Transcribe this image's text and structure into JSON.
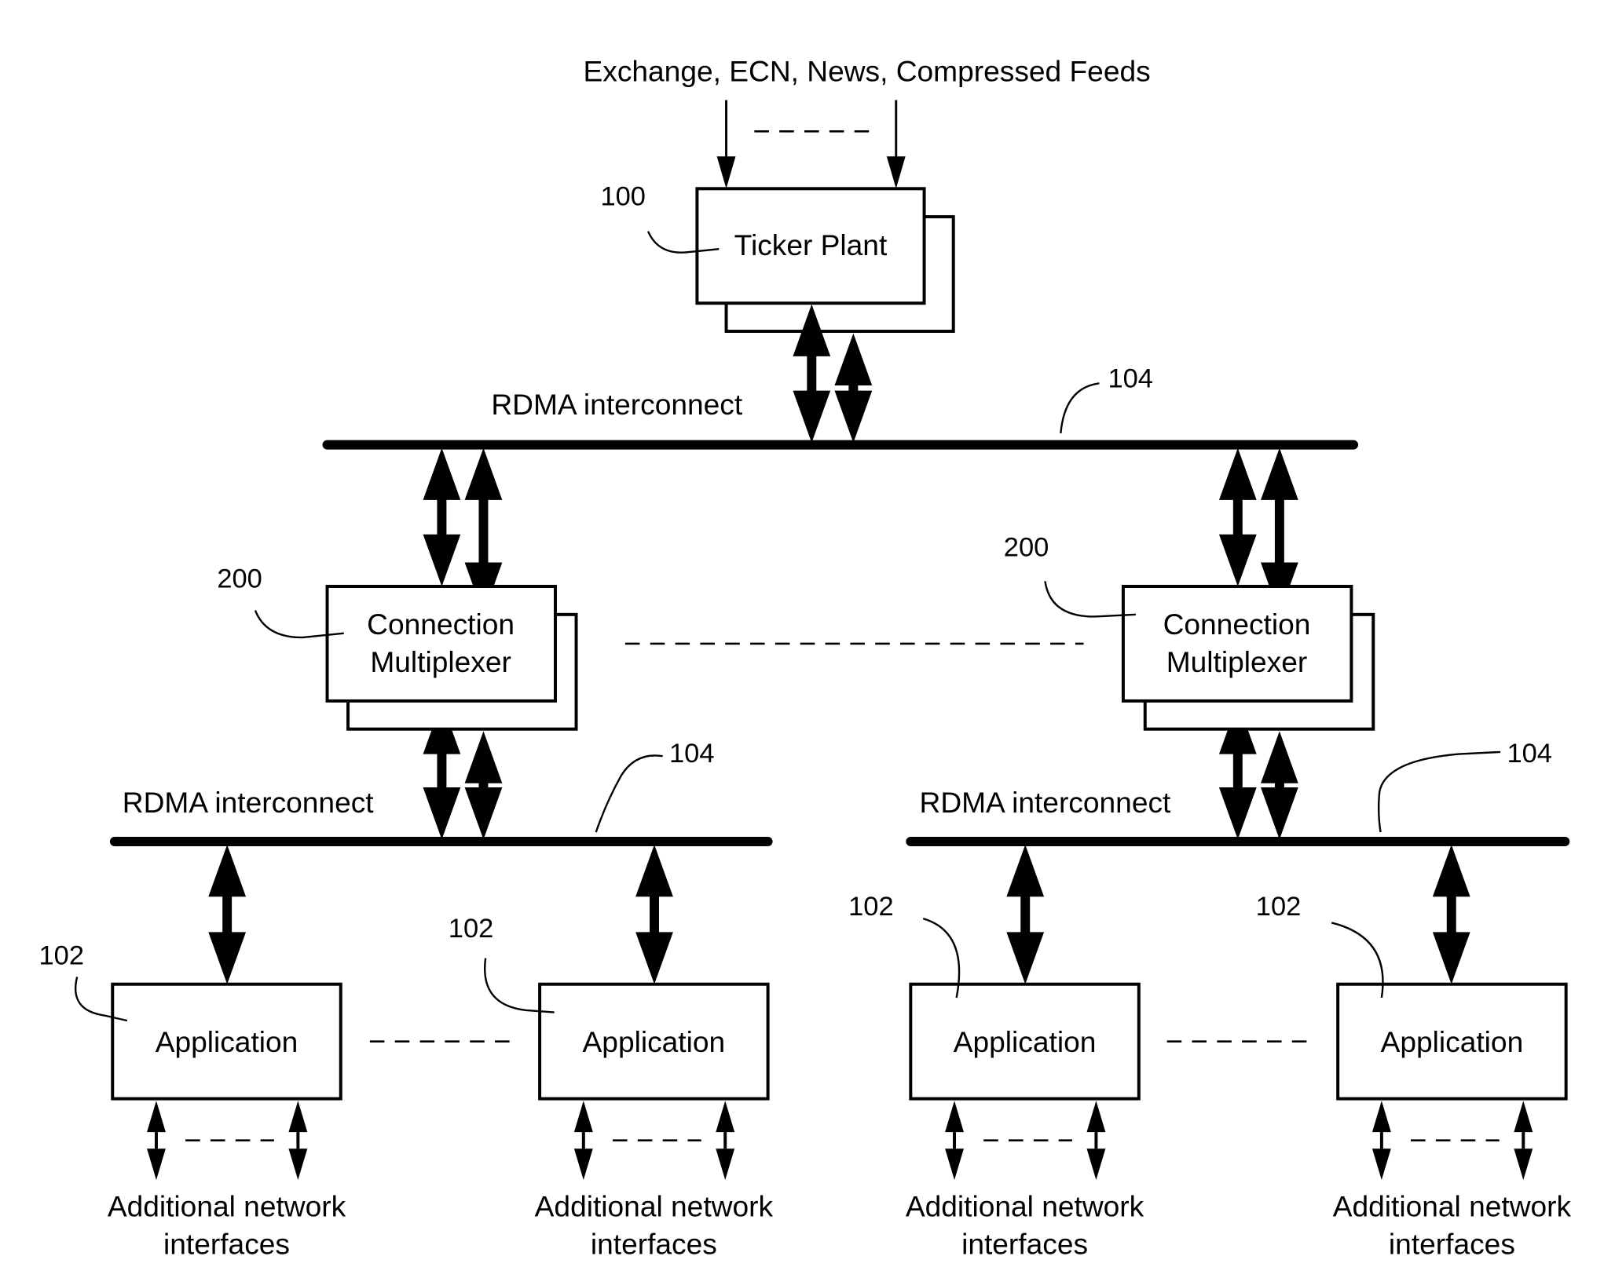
{
  "diagram": {
    "feeds_label": "Exchange, ECN, News, Compressed Feeds",
    "ticker_plant": {
      "label": "Ticker Plant",
      "ref": "100"
    },
    "rdma_label": "RDMA interconnect",
    "rdma_ref": "104",
    "connection_multiplexer": {
      "line1": "Connection",
      "line2": "Multiplexer",
      "ref": "200"
    },
    "application": {
      "label": "Application",
      "ref": "102"
    },
    "additional": {
      "line1": "Additional network",
      "line2": "interfaces"
    }
  }
}
